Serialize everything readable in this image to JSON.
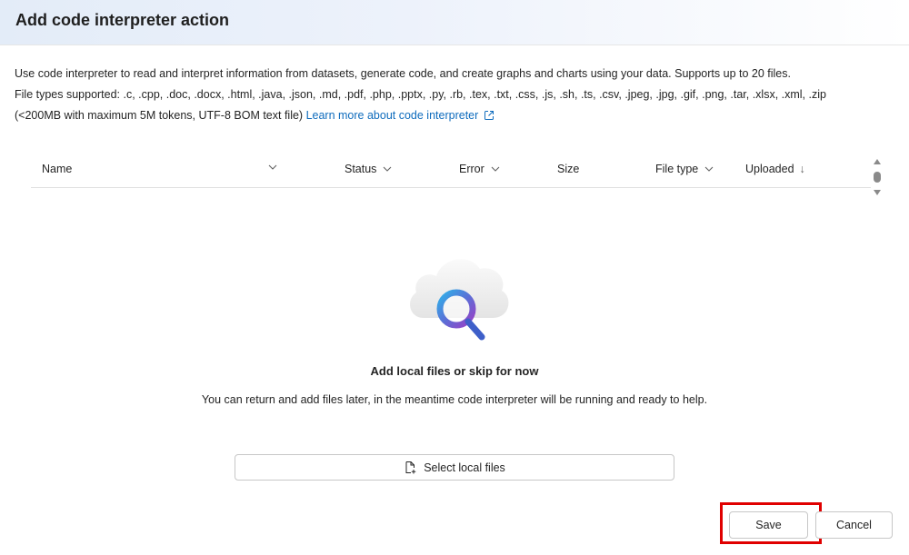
{
  "dialog": {
    "title": "Add code interpreter action"
  },
  "description": {
    "line1": "Use code interpreter to read and interpret information from datasets, generate code, and create graphs and charts using your data. Supports up to 20 files.",
    "line2": "File types supported: .c, .cpp, .doc, .docx, .html, .java, .json, .md, .pdf, .php, .pptx, .py, .rb, .tex, .txt, .css, .js, .sh, .ts, .csv, .jpeg, .jpg, .gif, .png, .tar, .xlsx, .xml, .zip",
    "line3": "(<200MB with maximum 5M tokens, UTF-8 BOM text file)",
    "learn_more": "Learn more about code interpreter"
  },
  "table": {
    "columns": {
      "name": "Name",
      "status": "Status",
      "error": "Error",
      "size": "Size",
      "file_type": "File type",
      "uploaded": "Uploaded"
    },
    "uploaded_sort_glyph": "↓"
  },
  "empty_state": {
    "title": "Add local files or skip for now",
    "description": "You can return and add files later, in the meantime code interpreter will be running and ready to help."
  },
  "actions": {
    "select_files": "Select local files",
    "save": "Save",
    "cancel": "Cancel"
  },
  "icons": {
    "empty_illustration": "cloud-search-icon",
    "select_files": "document-add-icon",
    "learn_more": "open-external-icon",
    "sort": "chevron-down-icon"
  },
  "colors": {
    "link": "#0f6cbd",
    "highlight": "#e00000"
  }
}
